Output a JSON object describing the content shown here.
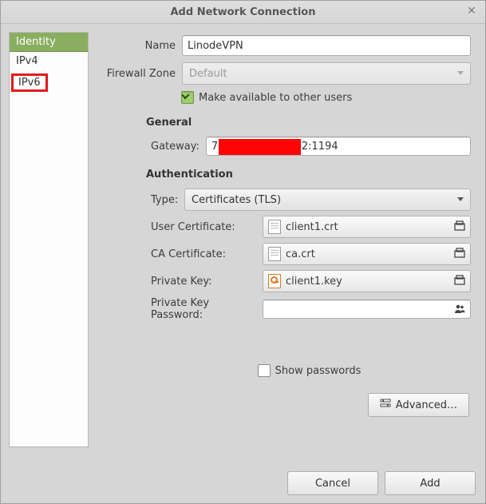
{
  "window": {
    "title": "Add Network Connection"
  },
  "sidebar": {
    "items": [
      {
        "label": "Identity"
      },
      {
        "label": "IPv4"
      },
      {
        "label": "IPv6"
      }
    ]
  },
  "form": {
    "name_label": "Name",
    "name_value": "LinodeVPN",
    "zone_label": "Firewall Zone",
    "zone_value": "Default",
    "share_label": "Make available to other users"
  },
  "general": {
    "heading": "General",
    "gateway_label": "Gateway:",
    "gateway_prefix": "7",
    "gateway_suffix": "2:1194"
  },
  "auth": {
    "heading": "Authentication",
    "type_label": "Type:",
    "type_value": "Certificates (TLS)",
    "user_cert_label": "User Certificate:",
    "user_cert_value": "client1.crt",
    "ca_cert_label": "CA Certificate:",
    "ca_cert_value": "ca.crt",
    "pkey_label": "Private Key:",
    "pkey_value": "client1.key",
    "pkey_pwd_label": "Private Key Password:",
    "show_pwd_label": "Show passwords"
  },
  "buttons": {
    "advanced": "Advanced…",
    "cancel": "Cancel",
    "add": "Add"
  }
}
